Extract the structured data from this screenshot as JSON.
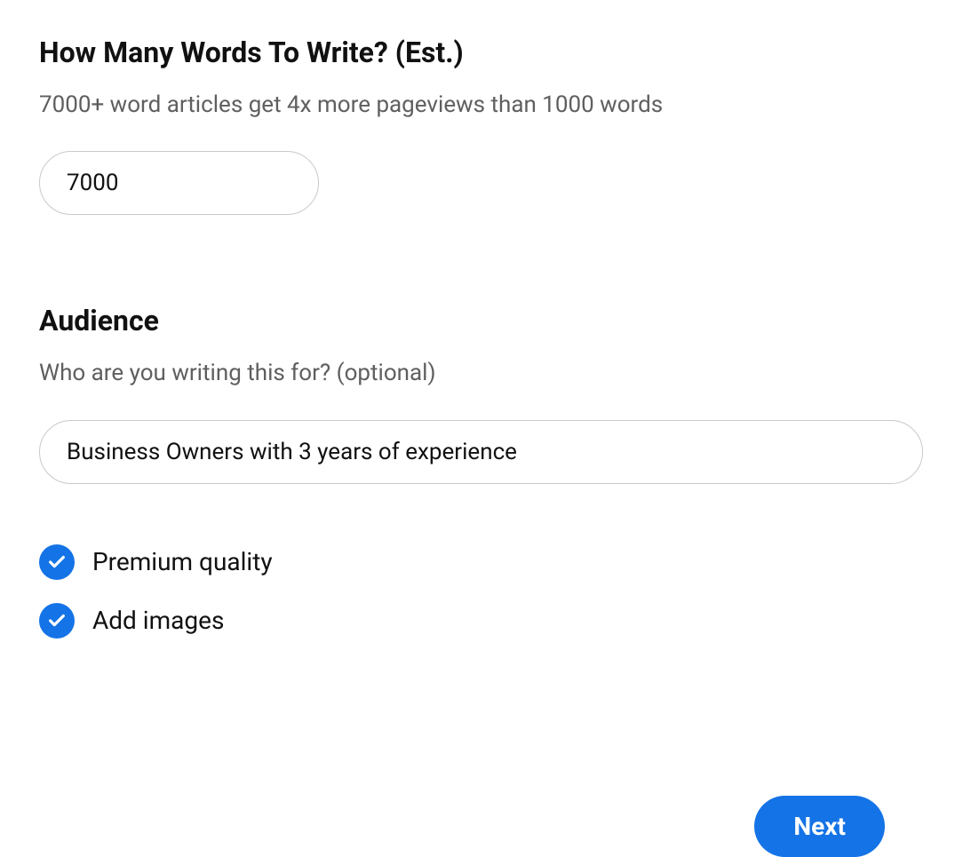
{
  "wordCount": {
    "title": "How Many Words To Write? (Est.)",
    "subtitle": "7000+ word articles get 4x more pageviews than 1000 words",
    "value": "7000"
  },
  "audience": {
    "title": "Audience",
    "subtitle": "Who are you writing this for? (optional)",
    "value": "Business Owners with 3 years of experience"
  },
  "options": {
    "premiumQuality": {
      "label": "Premium quality",
      "checked": true
    },
    "addImages": {
      "label": "Add images",
      "checked": true
    }
  },
  "actions": {
    "nextLabel": "Next"
  }
}
